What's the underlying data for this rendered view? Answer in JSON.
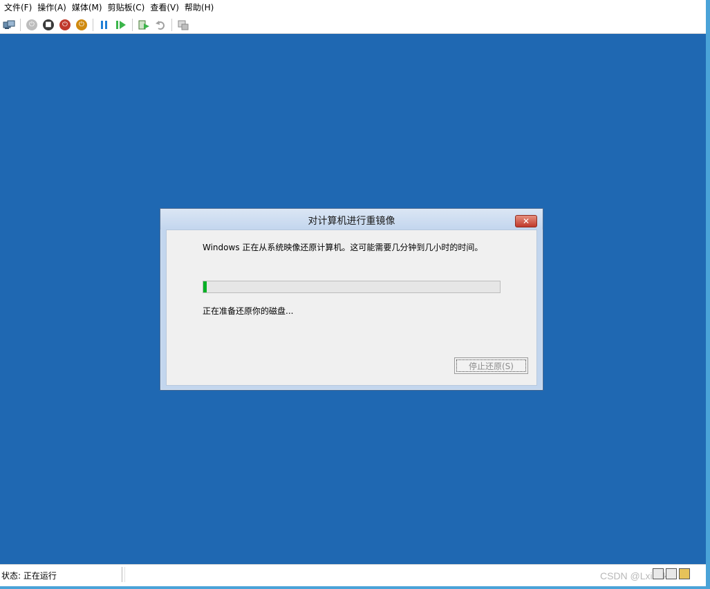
{
  "menubar": {
    "items": [
      "文件(F)",
      "操作(A)",
      "媒体(M)",
      "剪贴板(C)",
      "查看(V)",
      "帮助(H)"
    ]
  },
  "toolbar": {
    "buttons": [
      {
        "icon": "ctrl-alt-del-icon"
      },
      {
        "icon": "start-icon",
        "color": "#bdbdbd"
      },
      {
        "icon": "turn-off-icon",
        "color": "#3a3a3a"
      },
      {
        "icon": "shutdown-icon",
        "color": "#c0392b"
      },
      {
        "icon": "save-state-icon",
        "color": "#d08a10"
      },
      {
        "icon": "pause-icon",
        "color": "#1e7ed6"
      },
      {
        "icon": "resume-icon",
        "color": "#3bb54a"
      },
      {
        "icon": "checkpoint-icon"
      },
      {
        "icon": "revert-icon"
      },
      {
        "icon": "enhanced-session-icon"
      }
    ]
  },
  "colors": {
    "vm_background": "#1f68b2",
    "progress_fill": "#06b025",
    "dialog_border": "#4d6c92"
  },
  "dialog": {
    "title": "对计算机进行重镜像",
    "message": "Windows 正在从系统映像还原计算机。这可能需要几分钟到几小时的时间。",
    "progress_percent": 1,
    "status": "正在准备还原你的磁盘...",
    "stop_button": "停止还原(S)",
    "close_symbol": "✕"
  },
  "statusbar": {
    "status": "状态: 正在运行",
    "watermark": "CSDN @Lxiaoku"
  }
}
